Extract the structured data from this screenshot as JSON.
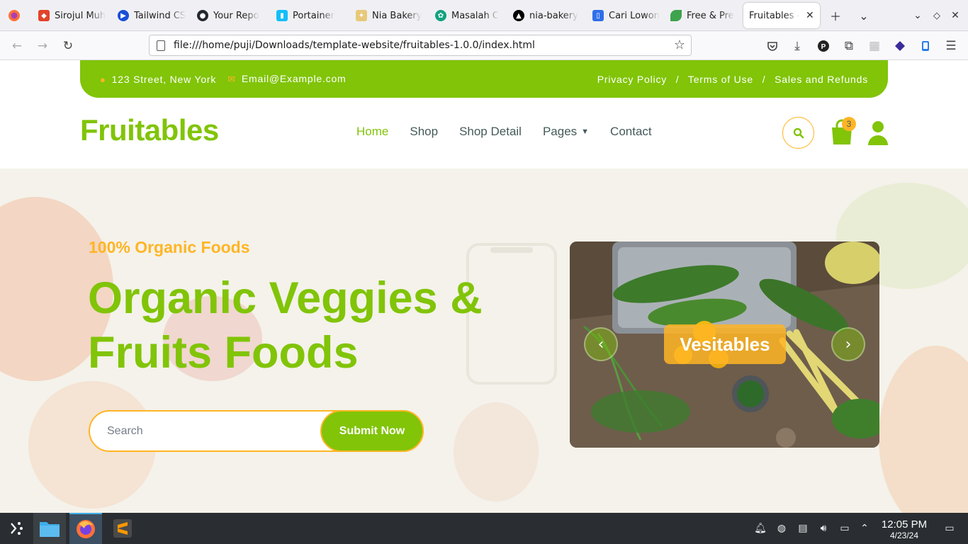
{
  "browser": {
    "tabs": [
      {
        "title": "Sirojul Muh",
        "icon": "gitlab-icon"
      },
      {
        "title": "Tailwind CS",
        "icon": "tailwind-icon"
      },
      {
        "title": "Your Repo",
        "icon": "github-icon"
      },
      {
        "title": "Portainer",
        "icon": "portainer-icon"
      },
      {
        "title": "Nia Bakery",
        "icon": "bakery-icon"
      },
      {
        "title": "Masalah C",
        "icon": "chatgpt-icon"
      },
      {
        "title": "nia-bakery",
        "icon": "vercel-icon"
      },
      {
        "title": "Cari Lowon",
        "icon": "job-icon"
      },
      {
        "title": "Free & Pre",
        "icon": "leaf-icon"
      },
      {
        "title": "Fruitables -",
        "icon": "none",
        "active": true
      }
    ],
    "url": "file:///home/puji/Downloads/template-website/fruitables-1.0.0/index.html"
  },
  "site": {
    "topbar": {
      "address": "123 Street, New York",
      "email": "Email@Example.com",
      "links": [
        "Privacy Policy",
        "Terms of Use",
        "Sales and Refunds"
      ],
      "separator": "/"
    },
    "logo": "Fruitables",
    "menu": [
      "Home",
      "Shop",
      "Shop Detail",
      "Pages",
      "Contact"
    ],
    "cart_count": "3",
    "hero": {
      "eyebrow": "100% Organic Foods",
      "headline_line1": "Organic Veggies &",
      "headline_line2": "Fruits Foods",
      "search_placeholder": "Search",
      "submit_label": "Submit Now",
      "slide_label": "Vesitables"
    }
  },
  "taskbar": {
    "time": "12:05 PM",
    "date": "4/23/24"
  },
  "colors": {
    "primary": "#81c408",
    "secondary": "#ffb524",
    "text": "#45595b"
  }
}
